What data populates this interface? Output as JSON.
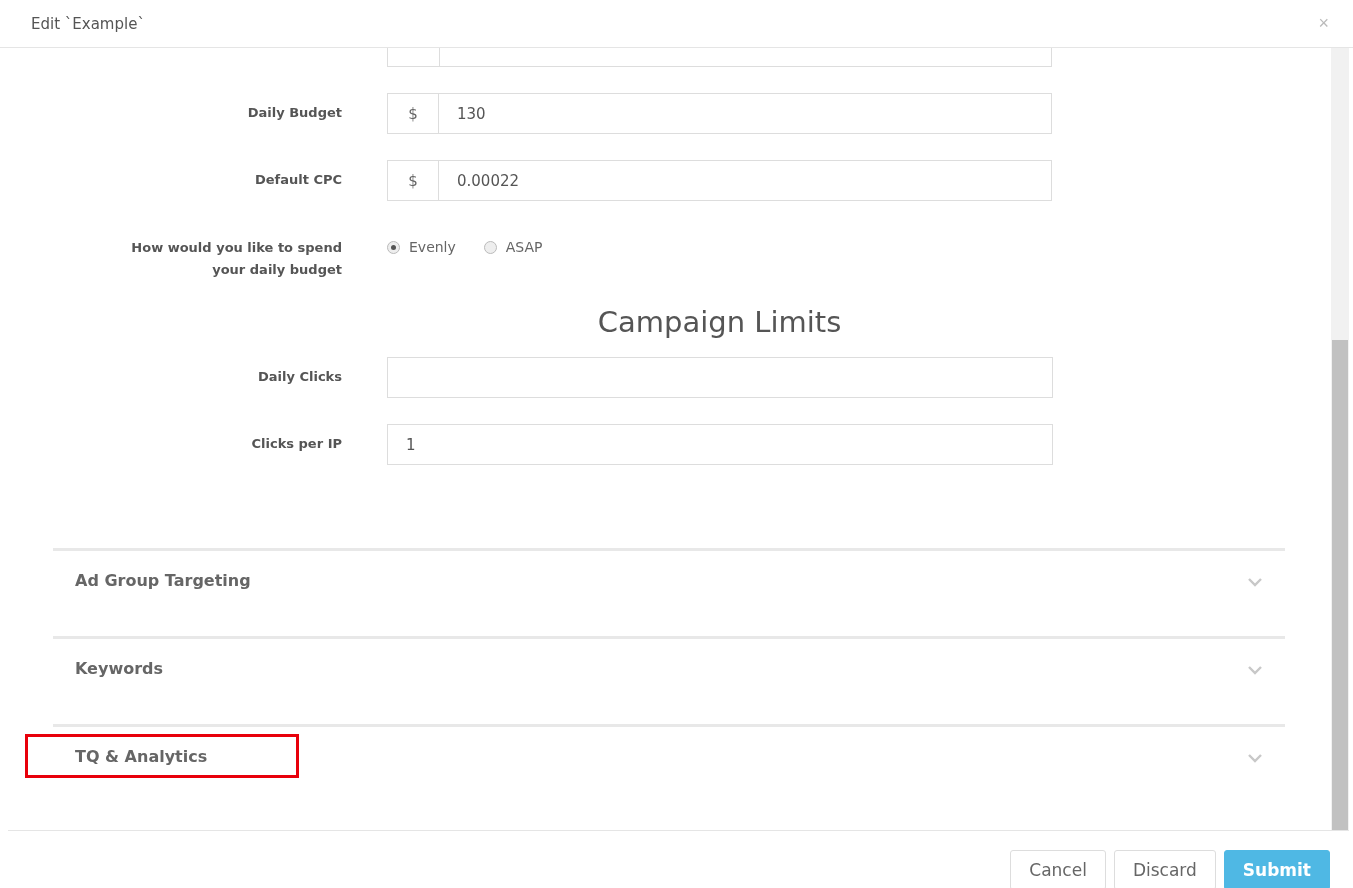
{
  "dialog": {
    "title": "Edit `Example`",
    "close": "×"
  },
  "fields": [
    {
      "label": "Daily Budget",
      "addon": "$",
      "value": "130"
    },
    {
      "label": "Default CPC",
      "addon": "$",
      "value": "0.00022"
    }
  ],
  "spend": {
    "label": "How would you like to spend your daily budget",
    "options": [
      {
        "label": "Evenly",
        "selected": true
      },
      {
        "label": "ASAP",
        "selected": false
      }
    ]
  },
  "limits": {
    "heading": "Campaign Limits",
    "fields": [
      {
        "label": "Daily Clicks"
      },
      {
        "label": "Clicks per IP",
        "value": "1"
      }
    ]
  },
  "sections": [
    {
      "title": "Ad Group Targeting",
      "expanded": false,
      "highlighted": false
    },
    {
      "title": "Keywords",
      "expanded": false,
      "highlighted": false
    },
    {
      "title": "TQ & Analytics",
      "expanded": false,
      "highlighted": true
    }
  ],
  "buttons": [
    {
      "label": "Cancel",
      "kind": "default"
    },
    {
      "label": "Discard",
      "kind": "default"
    },
    {
      "label": "Submit",
      "kind": "primary"
    }
  ]
}
